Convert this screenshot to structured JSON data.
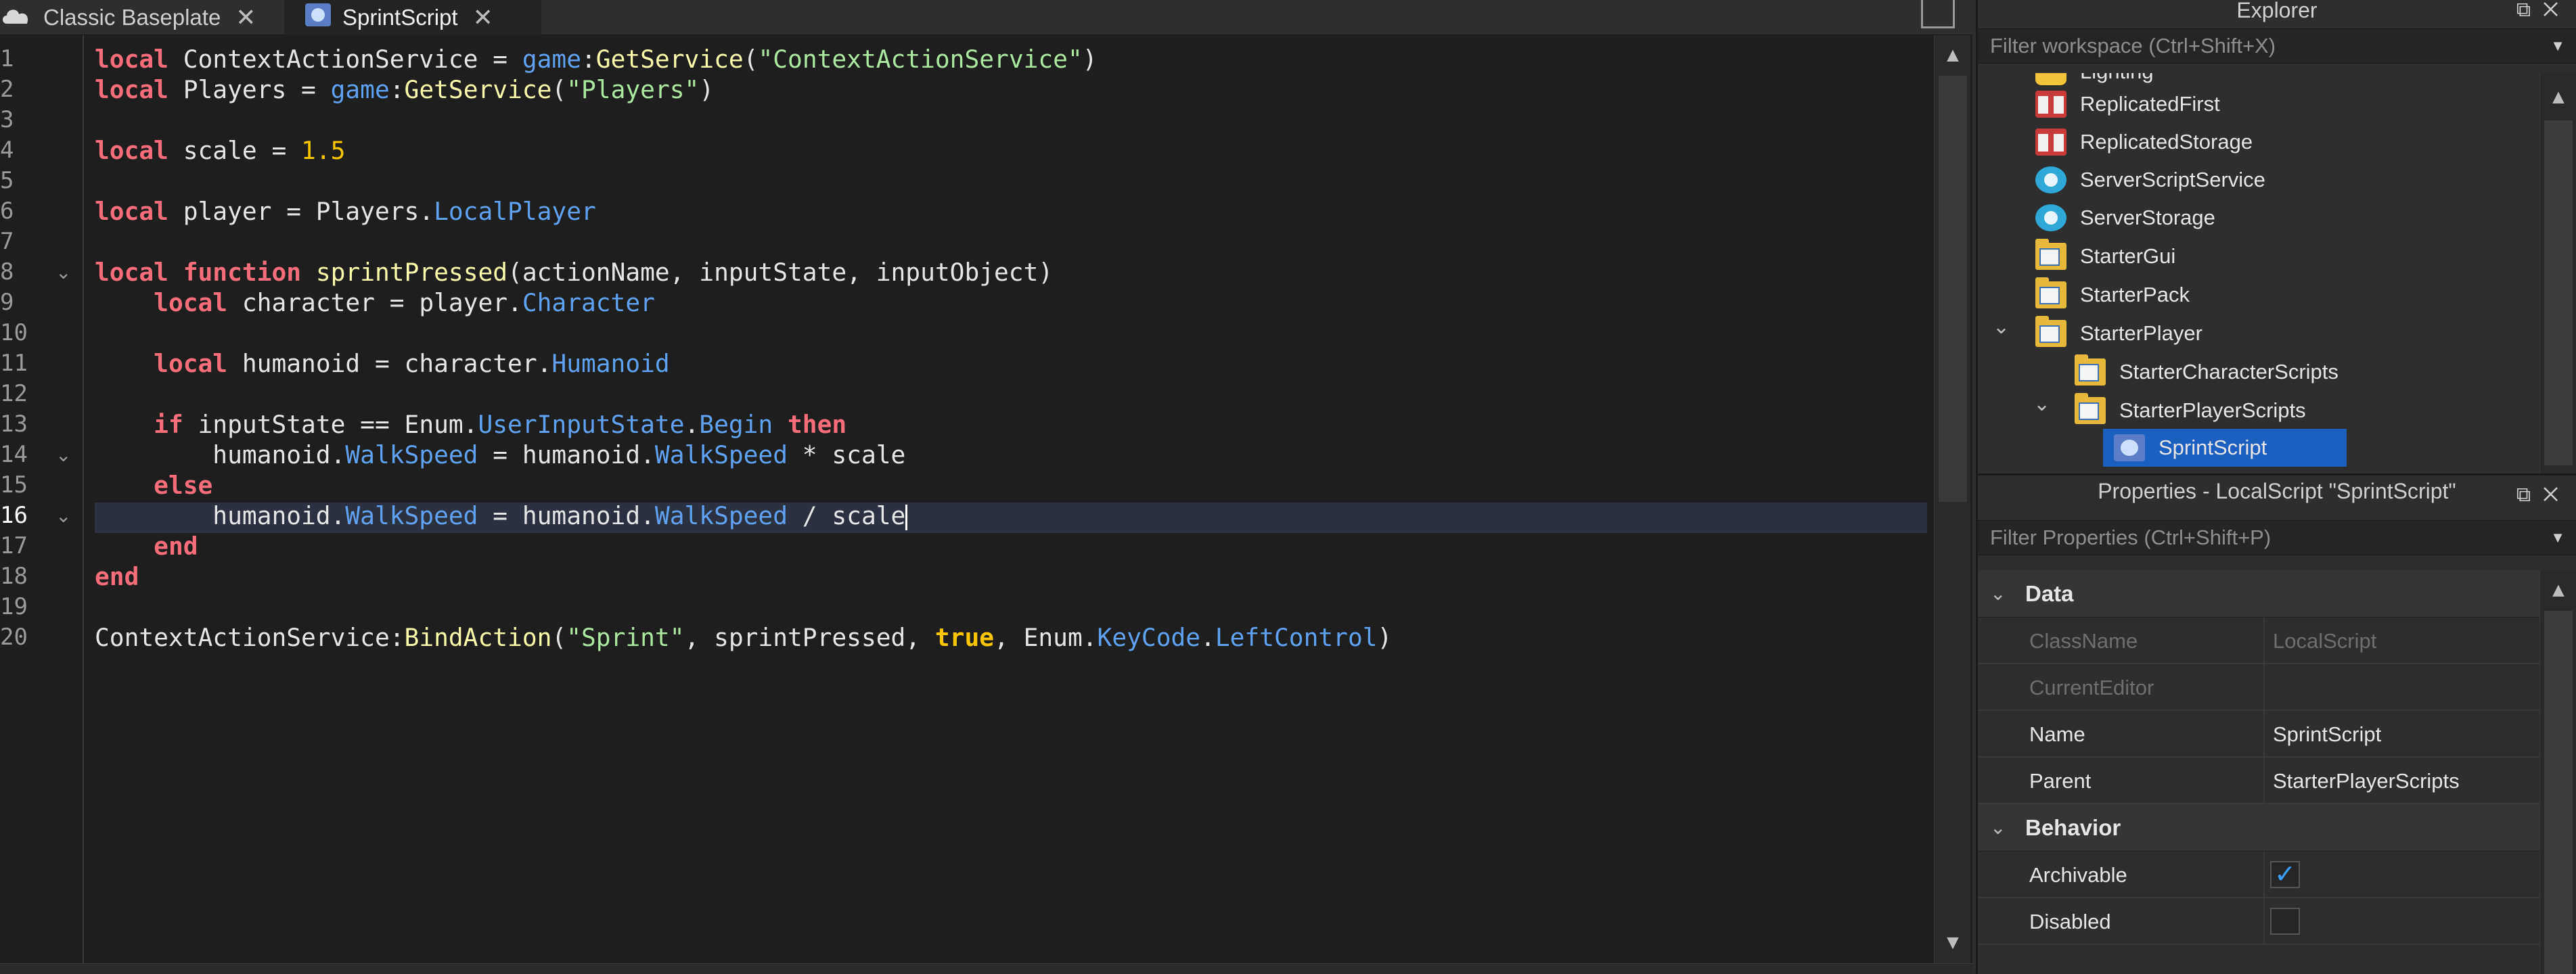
{
  "tabs": [
    {
      "label": "Classic Baseplate",
      "icon": "cloud-icon",
      "active": false
    },
    {
      "label": "SprintScript",
      "icon": "script-icon",
      "active": true
    }
  ],
  "editor": {
    "line_numbers": [
      "1",
      "2",
      "3",
      "4",
      "5",
      "6",
      "7",
      "8",
      "9",
      "10",
      "11",
      "12",
      "13",
      "14",
      "15",
      "16",
      "17",
      "18",
      "19",
      "20"
    ],
    "current_line": 16
  },
  "explorer": {
    "title": "Explorer",
    "filter_placeholder": "Filter workspace (Ctrl+Shift+X)",
    "items": [
      {
        "label": "Lighting",
        "icon": "lighting-icon"
      },
      {
        "label": "ReplicatedFirst",
        "icon": "replicated-first-icon"
      },
      {
        "label": "ReplicatedStorage",
        "icon": "replicated-storage-icon"
      },
      {
        "label": "ServerScriptService",
        "icon": "server-script-service-icon"
      },
      {
        "label": "ServerStorage",
        "icon": "server-storage-icon"
      },
      {
        "label": "StarterGui",
        "icon": "starter-gui-icon"
      },
      {
        "label": "StarterPack",
        "icon": "starter-pack-icon"
      },
      {
        "label": "StarterPlayer",
        "icon": "starter-player-icon"
      },
      {
        "label": "StarterCharacterScripts",
        "icon": "folder-icon"
      },
      {
        "label": "StarterPlayerScripts",
        "icon": "folder-icon"
      },
      {
        "label": "SprintScript",
        "icon": "local-script-icon",
        "selected": true
      }
    ]
  },
  "properties": {
    "title": "Properties - LocalScript \"SprintScript\"",
    "filter_placeholder": "Filter Properties (Ctrl+Shift+P)",
    "categories": [
      {
        "name": "Data",
        "rows": [
          {
            "name": "ClassName",
            "value": "LocalScript",
            "readonly": true
          },
          {
            "name": "CurrentEditor",
            "value": "",
            "readonly": true
          },
          {
            "name": "Name",
            "value": "SprintScript"
          },
          {
            "name": "Parent",
            "value": "StarterPlayerScripts"
          }
        ]
      },
      {
        "name": "Behavior",
        "rows": [
          {
            "name": "Archivable",
            "checked": true
          },
          {
            "name": "Disabled",
            "checked": false
          }
        ]
      }
    ]
  },
  "colors": {
    "keyword": "#f86d7c",
    "string": "#ade8a3",
    "number": "#ffc600",
    "property": "#61a1f1",
    "function": "#fdfbac",
    "selection": "#1b5fbf"
  }
}
